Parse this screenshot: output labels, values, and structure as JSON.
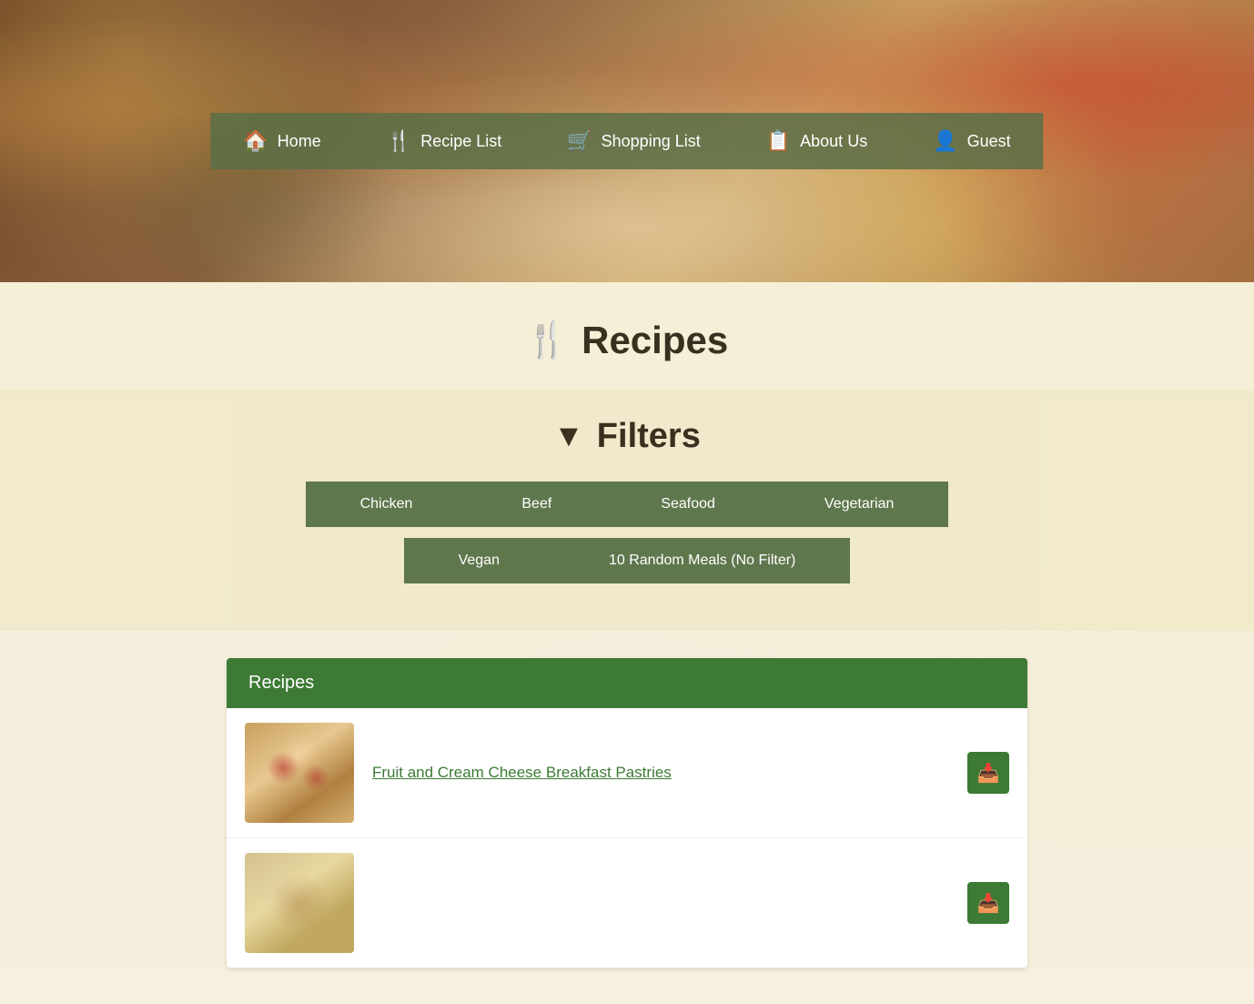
{
  "hero": {
    "alt": "Food ingredients background"
  },
  "nav": {
    "items": [
      {
        "id": "home",
        "label": "Home",
        "icon": "🏠"
      },
      {
        "id": "recipe-list",
        "label": "Recipe List",
        "icon": "🍴"
      },
      {
        "id": "shopping-list",
        "label": "Shopping List",
        "icon": "🛒"
      },
      {
        "id": "about-us",
        "label": "About Us",
        "icon": "📋"
      },
      {
        "id": "guest",
        "label": "Guest",
        "icon": "👤"
      }
    ]
  },
  "recipes_heading": {
    "icon": "🍴",
    "title": "Recipes"
  },
  "filters": {
    "heading": "Filters",
    "icon": "▼",
    "buttons_row1": [
      {
        "id": "chicken",
        "label": "Chicken"
      },
      {
        "id": "beef",
        "label": "Beef"
      },
      {
        "id": "seafood",
        "label": "Seafood"
      },
      {
        "id": "vegetarian",
        "label": "Vegetarian"
      }
    ],
    "buttons_row2": [
      {
        "id": "vegan",
        "label": "Vegan"
      },
      {
        "id": "random",
        "label": "10 Random Meals (No Filter)"
      }
    ]
  },
  "recipes_section": {
    "header": "Recipes",
    "items": [
      {
        "id": "recipe-1",
        "title": "Fruit and Cream Cheese Breakfast Pastries",
        "thumb_type": "pastry"
      },
      {
        "id": "recipe-2",
        "title": "",
        "thumb_type": "soup"
      }
    ]
  },
  "actions": {
    "add_to_list": "📥"
  }
}
